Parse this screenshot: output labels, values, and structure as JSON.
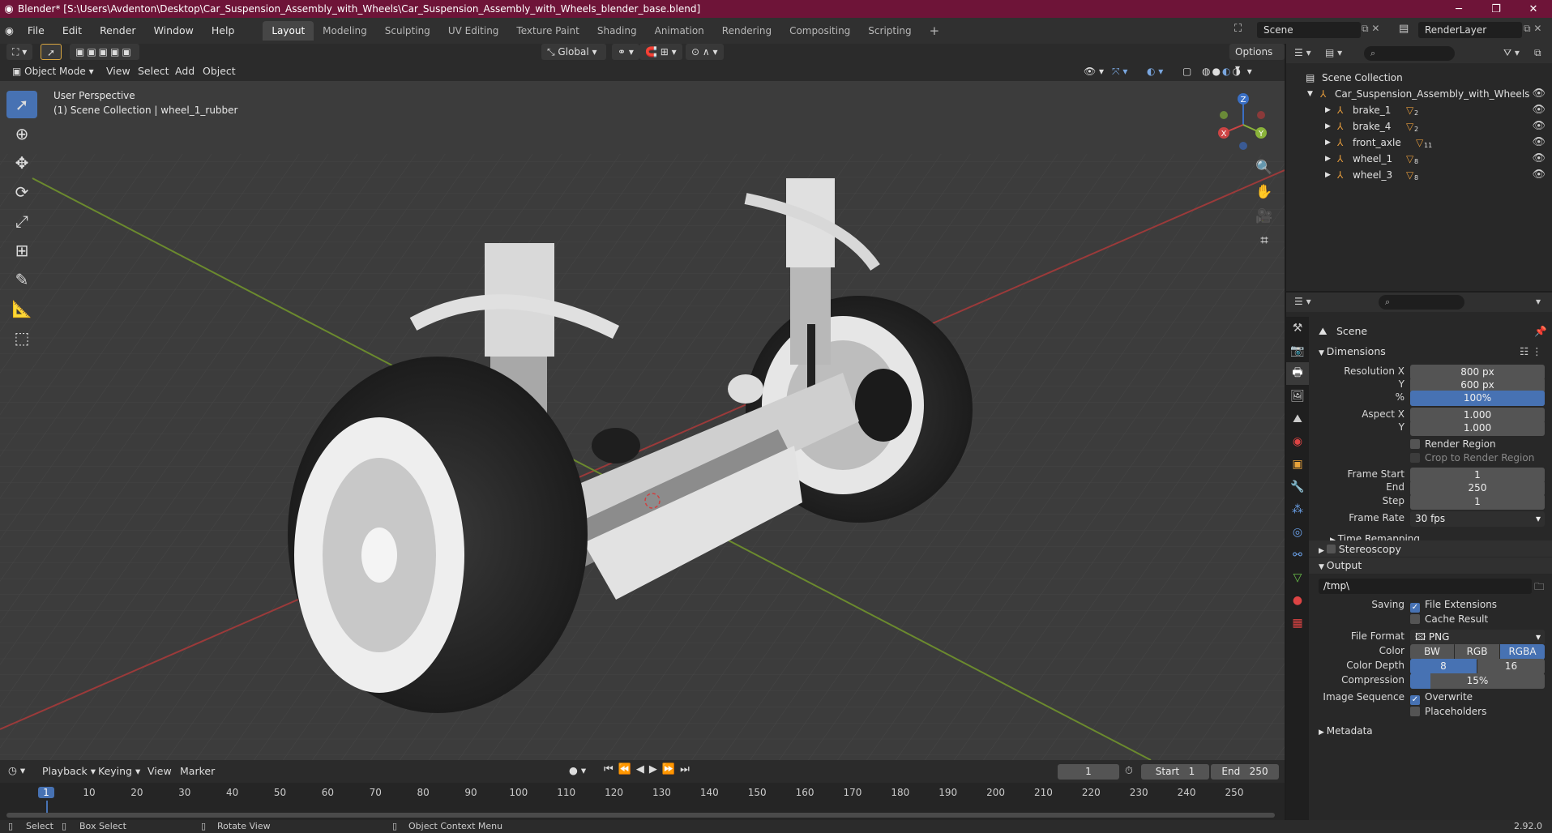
{
  "window": {
    "title": "Blender* [S:\\Users\\Avdenton\\Desktop\\Car_Suspension_Assembly_with_Wheels\\Car_Suspension_Assembly_with_Wheels_blender_base.blend]",
    "minimize_icon": "minimize-icon",
    "maximize_icon": "maximize-icon",
    "close_icon": "close-icon"
  },
  "menu": {
    "items": [
      "File",
      "Edit",
      "Render",
      "Window",
      "Help"
    ],
    "workspaces": [
      "Layout",
      "Modeling",
      "Sculpting",
      "UV Editing",
      "Texture Paint",
      "Shading",
      "Animation",
      "Rendering",
      "Compositing",
      "Scripting"
    ],
    "active_workspace": "Layout",
    "add_workspace": "+",
    "scene": "Scene",
    "render_layer": "RenderLayer"
  },
  "viewport_header": {
    "orientation": "Global",
    "options": "Options",
    "mode": "Object Mode",
    "menus": [
      "View",
      "Select",
      "Add",
      "Object"
    ]
  },
  "viewport": {
    "perspective": "User Perspective",
    "collection_info": "(1) Scene Collection | wheel_1_rubber",
    "gizmo": {
      "z": "Z",
      "x": "X",
      "y": "Y"
    }
  },
  "outliner": {
    "root": "Scene Collection",
    "collection": "Car_Suspension_Assembly_with_Wheels",
    "items": [
      {
        "name": "brake_1",
        "badge": "2"
      },
      {
        "name": "brake_4",
        "badge": "2"
      },
      {
        "name": "front_axle",
        "badge": "11"
      },
      {
        "name": "wheel_1",
        "badge": "8"
      },
      {
        "name": "wheel_3",
        "badge": "8"
      }
    ]
  },
  "properties": {
    "scene_name": "Scene",
    "dimensions_title": "Dimensions",
    "resolution_x_label": "Resolution X",
    "resolution_x": "800 px",
    "resolution_y_label": "Y",
    "resolution_y": "600 px",
    "percent_label": "%",
    "percent": "100%",
    "percent_fill": 1.0,
    "aspect_x_label": "Aspect X",
    "aspect_x": "1.000",
    "aspect_y_label": "Y",
    "aspect_y": "1.000",
    "render_region": "Render Region",
    "crop_region": "Crop to Render Region",
    "frame_start_label": "Frame Start",
    "frame_start": "1",
    "end_label": "End",
    "frame_end": "250",
    "step_label": "Step",
    "step": "1",
    "frame_rate_label": "Frame Rate",
    "frame_rate": "30 fps",
    "time_remapping": "Time Remapping",
    "stereoscopy": "Stereoscopy",
    "output_title": "Output",
    "output_path": "/tmp\\",
    "saving_label": "Saving",
    "file_extensions": "File Extensions",
    "cache_result": "Cache Result",
    "file_format_label": "File Format",
    "file_format": "PNG",
    "color_label": "Color",
    "color_options": [
      "BW",
      "RGB",
      "RGBA"
    ],
    "color_selected": "RGBA",
    "color_depth_label": "Color Depth",
    "color_depth_options": [
      "8",
      "16"
    ],
    "color_depth_selected": "8",
    "compression_label": "Compression",
    "compression": "15%",
    "compression_fill": 0.15,
    "image_sequence_label": "Image Sequence",
    "overwrite": "Overwrite",
    "placeholders": "Placeholders",
    "metadata": "Metadata"
  },
  "timeline": {
    "menus": [
      "Playback",
      "Keying",
      "View",
      "Marker"
    ],
    "current_frame": "1",
    "start_label": "Start",
    "start": "1",
    "end_label": "End",
    "end": "250",
    "ticks": [
      "1",
      "10",
      "20",
      "30",
      "40",
      "50",
      "60",
      "70",
      "80",
      "90",
      "100",
      "110",
      "120",
      "130",
      "140",
      "150",
      "160",
      "170",
      "180",
      "190",
      "200",
      "210",
      "220",
      "230",
      "240",
      "250"
    ]
  },
  "status": {
    "select": "Select",
    "box_select": "Box Select",
    "rotate_view": "Rotate View",
    "context_menu": "Object Context Menu",
    "version": "2.92.0"
  },
  "colors": {
    "accent": "#4772b3",
    "titlebar": "#6e1438",
    "axis_x": "#c8413f",
    "axis_y": "#8ab33a"
  }
}
